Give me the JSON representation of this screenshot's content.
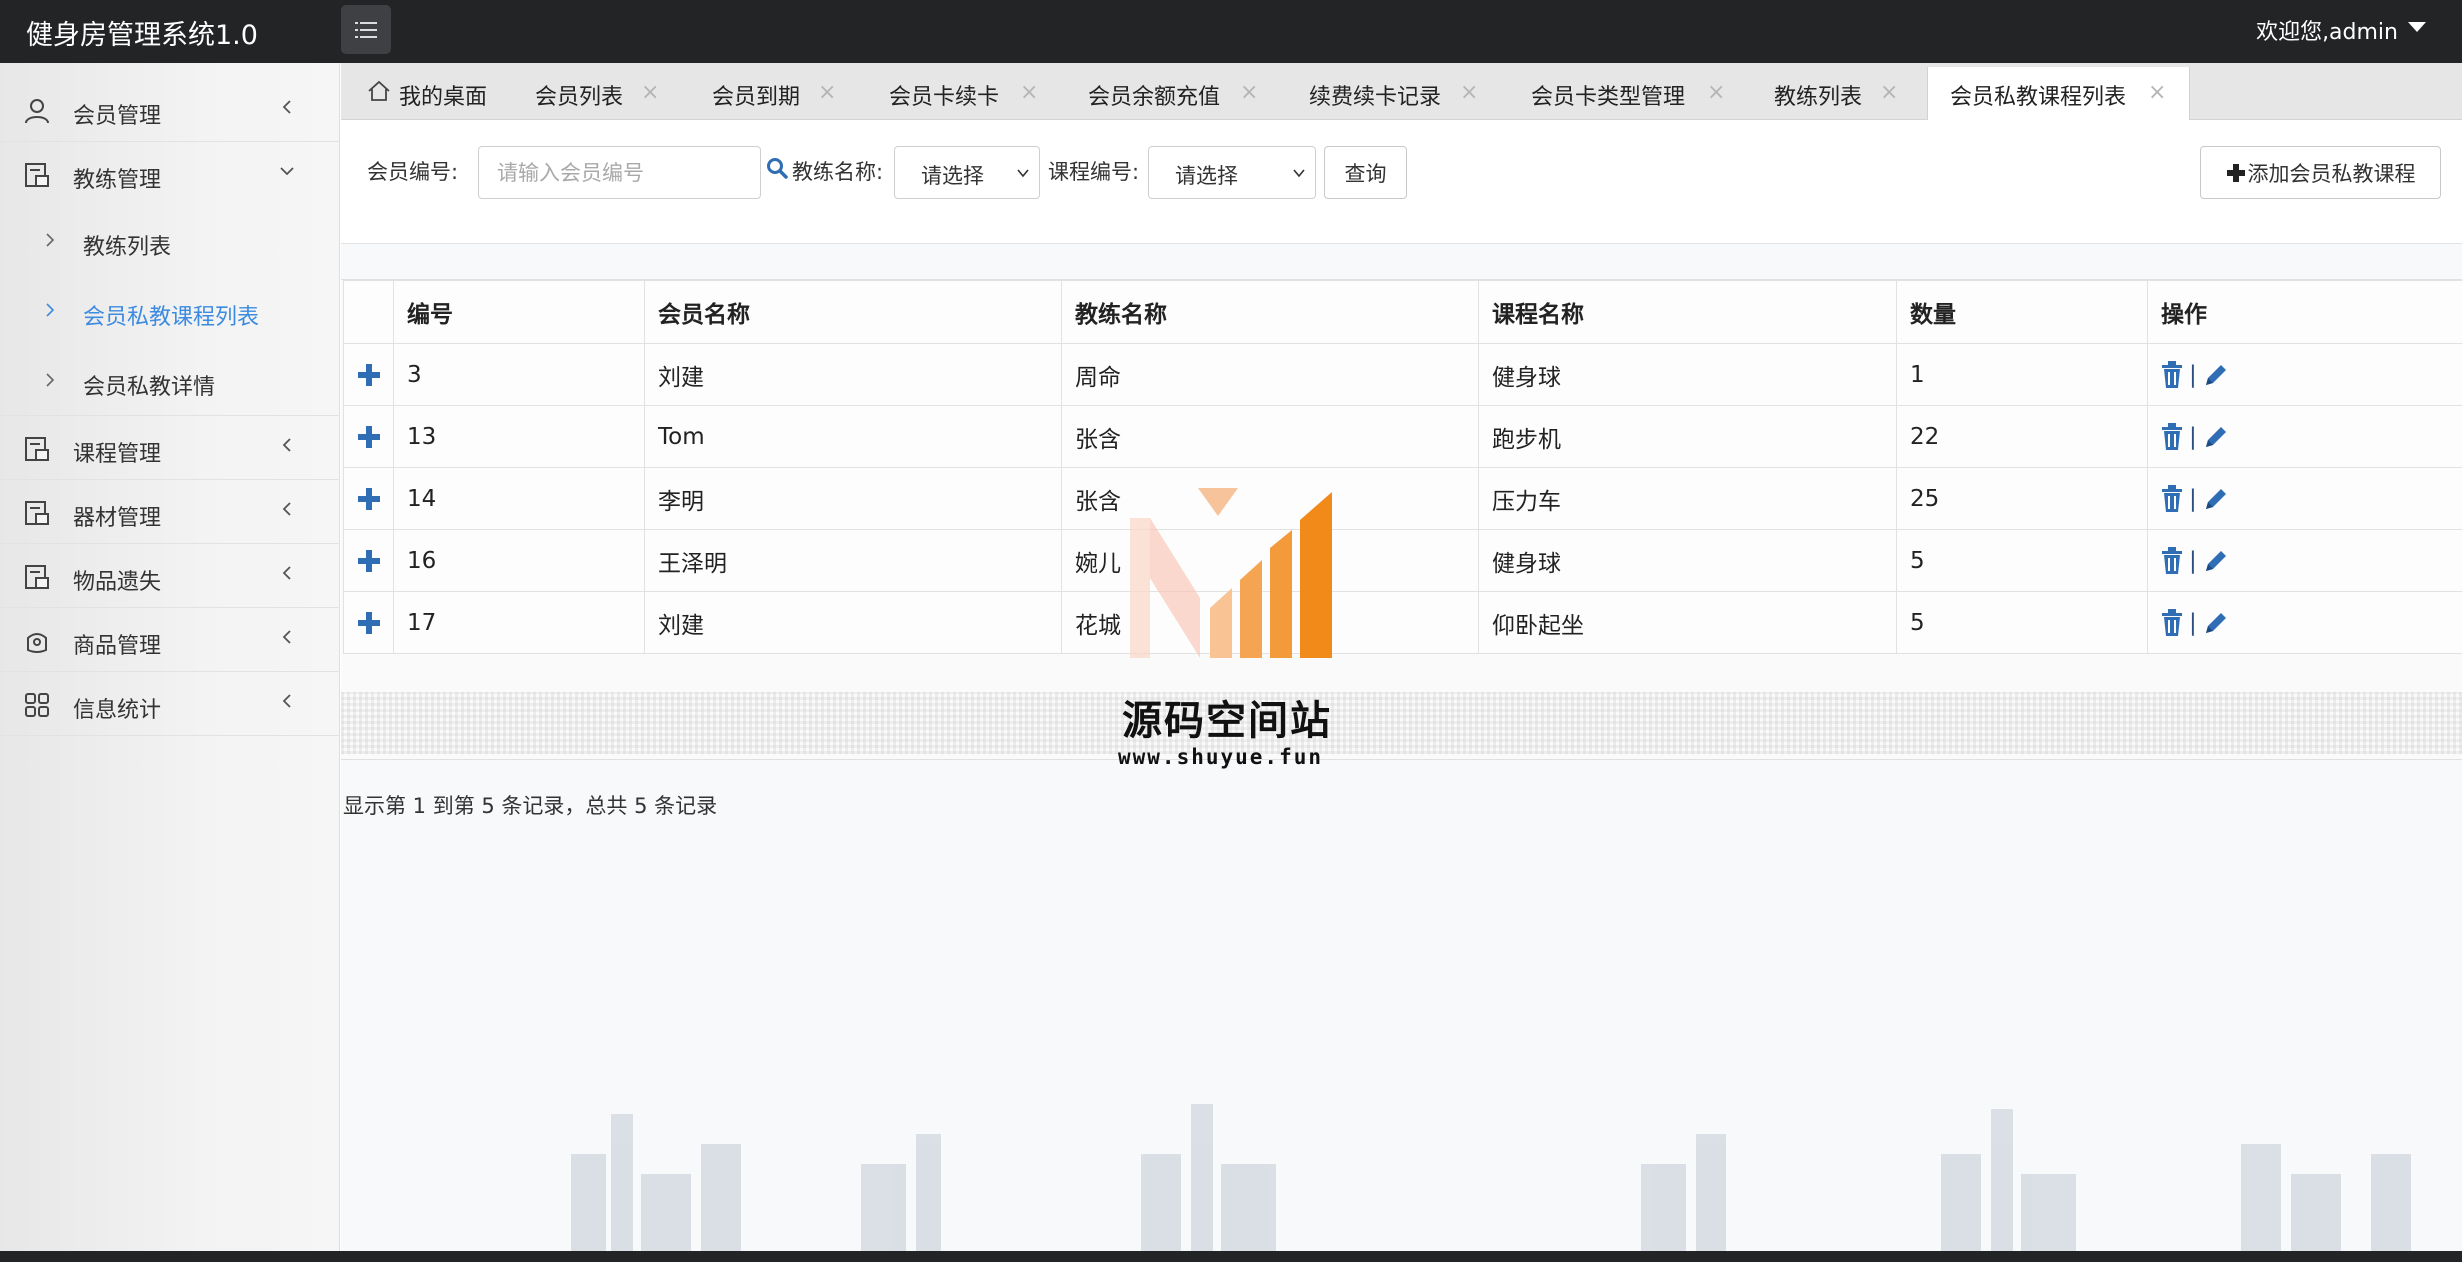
{
  "app": {
    "title": "健身房管理系统1.0",
    "user_menu": "欢迎您,admin"
  },
  "sidebar": {
    "items": [
      {
        "label": "会员管理",
        "icon": "user-icon",
        "expanded": false
      },
      {
        "label": "教练管理",
        "icon": "document-icon",
        "expanded": true,
        "children": [
          {
            "label": "教练列表",
            "active": false
          },
          {
            "label": "会员私教课程列表",
            "active": true
          },
          {
            "label": "会员私教详情",
            "active": false
          }
        ]
      },
      {
        "label": "课程管理",
        "icon": "document-icon",
        "expanded": false
      },
      {
        "label": "器材管理",
        "icon": "document-icon",
        "expanded": false
      },
      {
        "label": "物品遗失",
        "icon": "document-icon",
        "expanded": false
      },
      {
        "label": "商品管理",
        "icon": "bag-icon",
        "expanded": false
      },
      {
        "label": "信息统计",
        "icon": "grid-icon",
        "expanded": false
      }
    ]
  },
  "tabs": [
    {
      "label": "我的桌面",
      "icon": "home-icon",
      "closable": false,
      "active": false
    },
    {
      "label": "会员列表",
      "closable": true,
      "active": false
    },
    {
      "label": "会员到期",
      "closable": true,
      "active": false
    },
    {
      "label": "会员卡续卡",
      "closable": true,
      "active": false
    },
    {
      "label": "会员余额充值",
      "closable": true,
      "active": false
    },
    {
      "label": "续费续卡记录",
      "closable": true,
      "active": false
    },
    {
      "label": "会员卡类型管理",
      "closable": true,
      "active": false
    },
    {
      "label": "教练列表",
      "closable": true,
      "active": false
    },
    {
      "label": "会员私教课程列表",
      "closable": true,
      "active": true
    }
  ],
  "tab_close_glyph": "×",
  "filters": {
    "member_no_label": "会员编号:",
    "member_no_placeholder": "请输入会员编号",
    "coach_label": "教练名称:",
    "coach_value": "请选择",
    "course_label": "课程编号:",
    "course_value": "请选择",
    "query_button": "查询",
    "add_button": "添加会员私教课程"
  },
  "table": {
    "columns": [
      "编号",
      "会员名称",
      "教练名称",
      "课程名称",
      "数量",
      "操作"
    ],
    "rows": [
      {
        "id": "3",
        "member": "刘建",
        "coach": "周命",
        "course": "健身球",
        "qty": "1"
      },
      {
        "id": "13",
        "member": "Tom",
        "coach": "张含",
        "course": "跑步机",
        "qty": "22"
      },
      {
        "id": "14",
        "member": "李明",
        "coach": "张含",
        "course": "压力车",
        "qty": "25"
      },
      {
        "id": "16",
        "member": "王泽明",
        "coach": "婉儿",
        "course": "健身球",
        "qty": "5"
      },
      {
        "id": "17",
        "member": "刘建",
        "coach": "花城",
        "course": "仰卧起坐",
        "qty": "5"
      }
    ],
    "op_separator": "|"
  },
  "pagination": {
    "info": "显示第 1 到第 5 条记录，总共 5 条记录"
  },
  "watermark": {
    "title": "源码空间站",
    "url": "www.shuyue.fun"
  },
  "colors": {
    "topbar": "#222426",
    "accent_blue": "#3d8be0",
    "icon_blue": "#2f6db5",
    "logo_orange": "#f28a1a"
  }
}
